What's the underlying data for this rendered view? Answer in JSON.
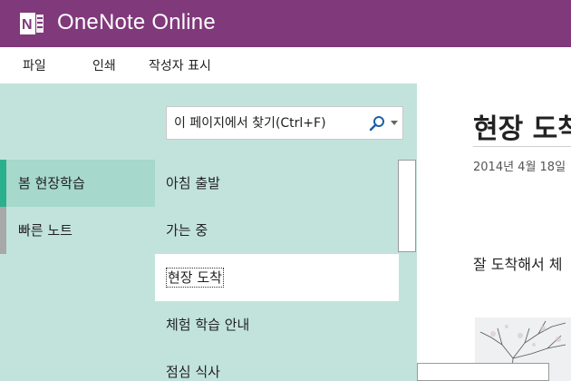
{
  "app": {
    "title": "OneNote Online",
    "brand_color": "#80397b"
  },
  "menu": {
    "items": [
      "파일",
      "인쇄",
      "작성자 표시"
    ]
  },
  "sections": {
    "items": [
      {
        "label": "봄 현장학습",
        "color": "#2bb08e",
        "active": true
      },
      {
        "label": "빠른 노트",
        "color": "#a8a8a8",
        "active": false
      }
    ]
  },
  "search": {
    "placeholder": "이 페이지에서 찾기(Ctrl+F)"
  },
  "pages": {
    "items": [
      {
        "label": "아침 출발",
        "selected": false
      },
      {
        "label": "가는 중",
        "selected": false
      },
      {
        "label": "현장 도착",
        "selected": true
      },
      {
        "label": "체험 학습 안내",
        "selected": false
      },
      {
        "label": "점심 식사",
        "selected": false
      }
    ]
  },
  "content": {
    "title": "현장 도착",
    "date": "2014년 4월 18일",
    "body": "잘 도착해서 체"
  },
  "colors": {
    "pane_bg": "#c2e3dc",
    "active_section_bg": "#a6d8cc"
  }
}
